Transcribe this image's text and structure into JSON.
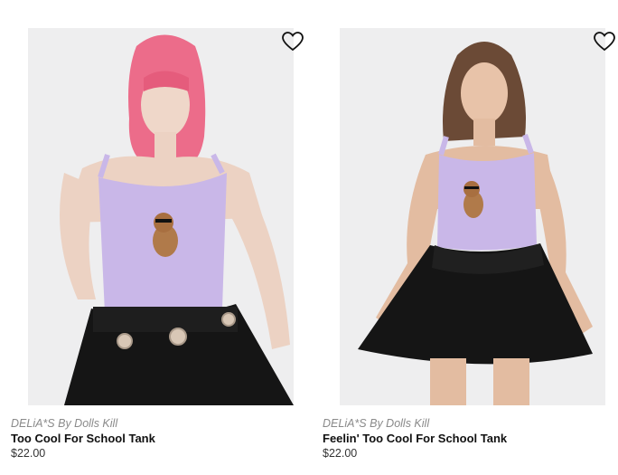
{
  "products": [
    {
      "brand": "DELiA*S By Dolls Kill",
      "title": "Too Cool For School Tank",
      "price": "$22.00",
      "image_icon": "product-photo-icon",
      "favorite_icon": "heart-icon"
    },
    {
      "brand": "DELiA*S By Dolls Kill",
      "title": "Feelin' Too Cool For School Tank",
      "price": "$22.00",
      "image_icon": "product-photo-icon",
      "favorite_icon": "heart-icon"
    }
  ],
  "colors": {
    "tank_lavender": "#c9b7e8",
    "skirt_black": "#151515",
    "background_grey": "#eeeeef",
    "brand_text": "#8a8a8a"
  }
}
